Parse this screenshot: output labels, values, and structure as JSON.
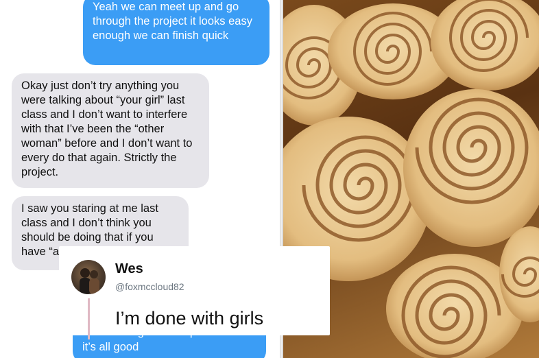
{
  "messages": {
    "sent_1": "Yeah we can meet up and go through the project it looks easy enough we can finish quick",
    "received_1": "Okay just don’t try anything you were talking about “your girl” last class and I don’t want to interfere with that I’ve been the “other woman” before and I don’t want to every do that again. Strictly the project.",
    "received_2": "I saw you staring at me last class and I don’t think you should be doing that if you have “a",
    "sent_2_partial": "didn’t I will get a new partner",
    "sent_2": "it’s all good"
  },
  "tweet": {
    "name": "Wes",
    "handle": "@foxmccloud82",
    "text": "I’m done with girls"
  },
  "colors": {
    "sent_bubble": "#3b9df5",
    "received_bubble": "#e6e5ea",
    "thread_line": "#e0b9c4"
  }
}
